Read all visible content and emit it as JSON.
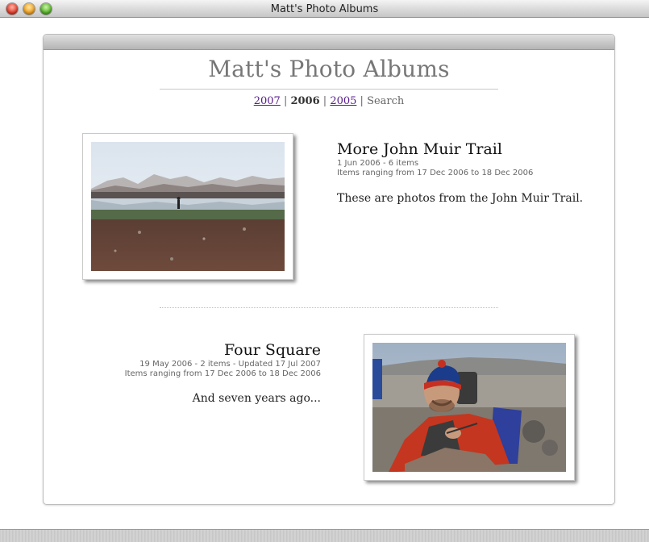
{
  "window": {
    "title": "Matt's Photo Albums"
  },
  "page": {
    "title": "Matt's Photo Albums"
  },
  "year_nav": {
    "items": [
      {
        "label": "2007",
        "kind": "link"
      },
      {
        "label": "2006",
        "kind": "current"
      },
      {
        "label": "2005",
        "kind": "link"
      },
      {
        "label": "Search",
        "kind": "plain"
      }
    ],
    "separator": " | "
  },
  "albums": [
    {
      "title": "More John Muir Trail",
      "meta_line1": "1 Jun 2006 - 6 items",
      "meta_line2": "Items ranging from 17 Dec 2006 to 18 Dec 2006",
      "description": "These are photos from the John Muir Trail."
    },
    {
      "title": "Four Square",
      "meta_line1": "19 May 2006 - 2 items - Updated 17 Jul 2007",
      "meta_line2": "Items ranging from 17 Dec 2006 to 18 Dec 2006",
      "description": "And seven years ago..."
    }
  ],
  "colors": {
    "link": "#551a8b",
    "title": "#777777"
  }
}
